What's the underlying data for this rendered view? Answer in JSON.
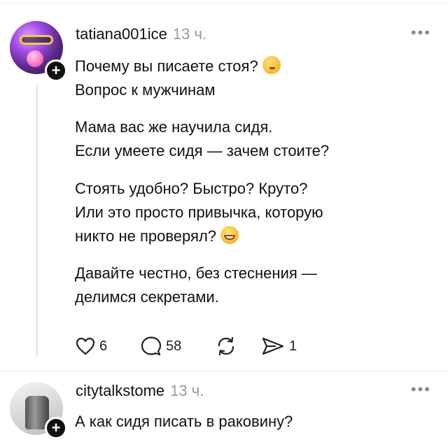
{
  "post": {
    "author": "tatiana001ice",
    "time": "13 ч.",
    "more": "•••",
    "lines": [
      "Почему вы писаете стоя?",
      "Вопрос к мужчинам",
      "Мама вас же научила сидя.",
      "Если умеете сидя — зачем стоите?",
      "Стоять удобно? Быстро? Круто?",
      "Или это просто привычка, которую",
      "никто не проверял?",
      "Давайте честно, без стеснения —",
      "делимся секретами."
    ],
    "emojis": [
      "thinking-face-emoji",
      "grinning-face-emoji"
    ],
    "stats": {
      "likes": "6",
      "replies": "58",
      "shares": "1"
    }
  },
  "reply": {
    "author": "citytalkstome",
    "time": "13 ч.",
    "more": "•••",
    "text": "А как сидя писать в раковину?"
  },
  "follow_button_label": "+"
}
